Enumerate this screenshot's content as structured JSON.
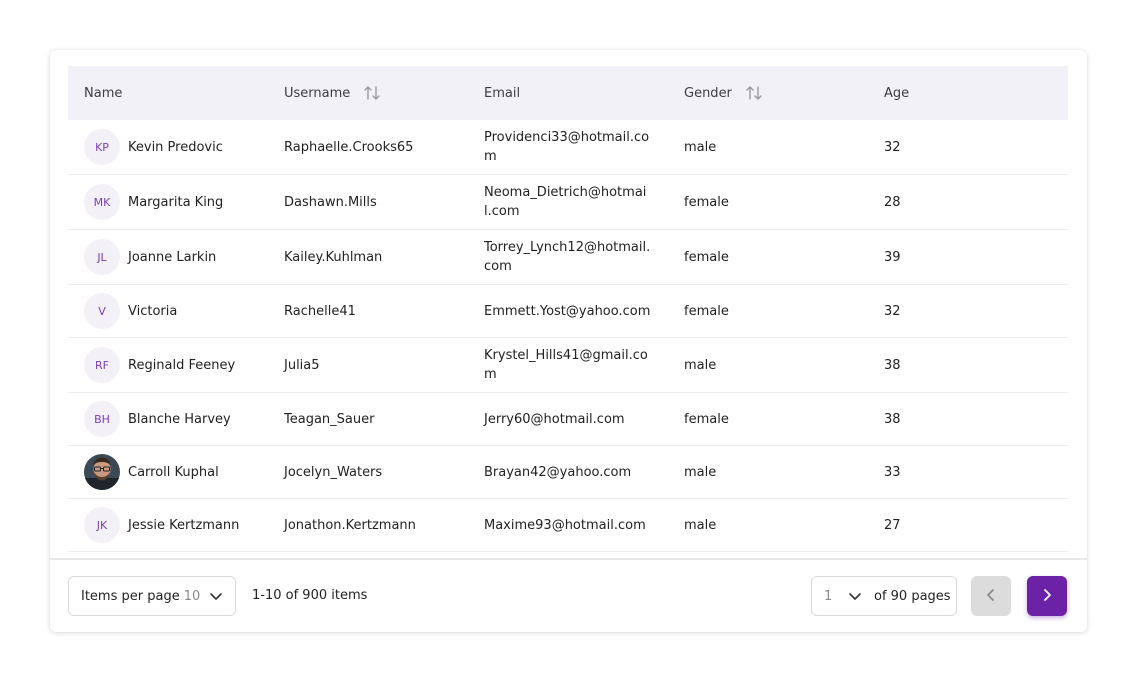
{
  "table": {
    "columns": {
      "name": "Name",
      "username": "Username",
      "email": "Email",
      "gender": "Gender",
      "age": "Age"
    },
    "rows": [
      {
        "initials": "KP",
        "name": "Kevin Predovic",
        "username": "Raphaelle.Crooks65",
        "email": "Providenci33@hotmail.com",
        "gender": "male",
        "age": "32"
      },
      {
        "initials": "MK",
        "name": "Margarita King",
        "username": "Dashawn.Mills",
        "email": "Neoma_Dietrich@hotmail.com",
        "gender": "female",
        "age": "28"
      },
      {
        "initials": "JL",
        "name": "Joanne Larkin",
        "username": "Kailey.Kuhlman",
        "email": "Torrey_Lynch12@hotmail.com",
        "gender": "female",
        "age": "39"
      },
      {
        "initials": "V",
        "name": "Victoria",
        "username": "Rachelle41",
        "email": "Emmett.Yost@yahoo.com",
        "gender": "female",
        "age": "32"
      },
      {
        "initials": "RF",
        "name": "Reginald Feeney",
        "username": "Julia5",
        "email": "Krystel_Hills41@gmail.com",
        "gender": "male",
        "age": "38"
      },
      {
        "initials": "BH",
        "name": "Blanche Harvey",
        "username": "Teagan_Sauer",
        "email": "Jerry60@hotmail.com",
        "gender": "female",
        "age": "38"
      },
      {
        "initials": "",
        "name": "Carroll Kuphal",
        "username": "Jocelyn_Waters",
        "email": "Brayan42@yahoo.com",
        "gender": "male",
        "age": "33"
      },
      {
        "initials": "JK",
        "name": "Jessie Kertzmann",
        "username": "Jonathon.Kertzmann",
        "email": "Maxime93@hotmail.com",
        "gender": "male",
        "age": "27"
      }
    ]
  },
  "footer": {
    "items_per_page_label": "Items per page",
    "items_per_page_value": "10",
    "range_text": "1-10 of 900 items",
    "page_value": "1",
    "of_pages_text": "of 90 pages"
  },
  "icons": {
    "sort": "sort-arrows-icon",
    "dropdown": "chevron-down-icon",
    "prev": "chevron-left-icon",
    "next": "chevron-right-icon"
  },
  "colors": {
    "accent": "#6b22a6",
    "header_bg": "#f3f1f8",
    "avatar_text": "#7b3fb0"
  }
}
